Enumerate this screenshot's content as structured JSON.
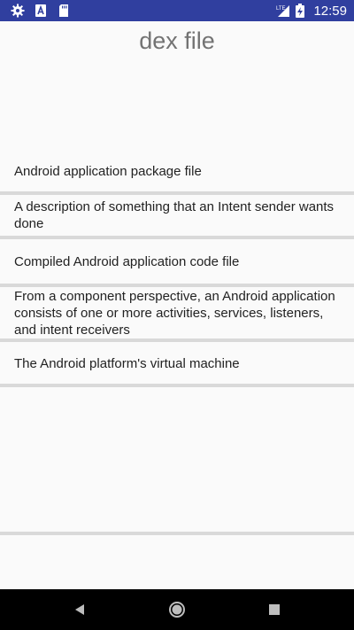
{
  "status_bar": {
    "time": "12:59",
    "left_icons": [
      "gear-icon",
      "text-a-icon",
      "sd-card-icon"
    ],
    "right_icons": [
      "signal-lte-icon",
      "battery-charging-icon"
    ],
    "background": "#303f9f"
  },
  "question": {
    "text": "dex file"
  },
  "options": [
    {
      "label": "Android application package file"
    },
    {
      "label": "A description of something that an Intent sender wants done"
    },
    {
      "label": "Compiled Android application code file"
    },
    {
      "label": "From a component perspective, an Android application consists of one or more activities, services, listeners, and intent receivers"
    },
    {
      "label": "The Android platform's virtual machine"
    }
  ],
  "nav_bar": {
    "buttons": [
      "back-icon",
      "home-icon",
      "recents-icon"
    ]
  }
}
